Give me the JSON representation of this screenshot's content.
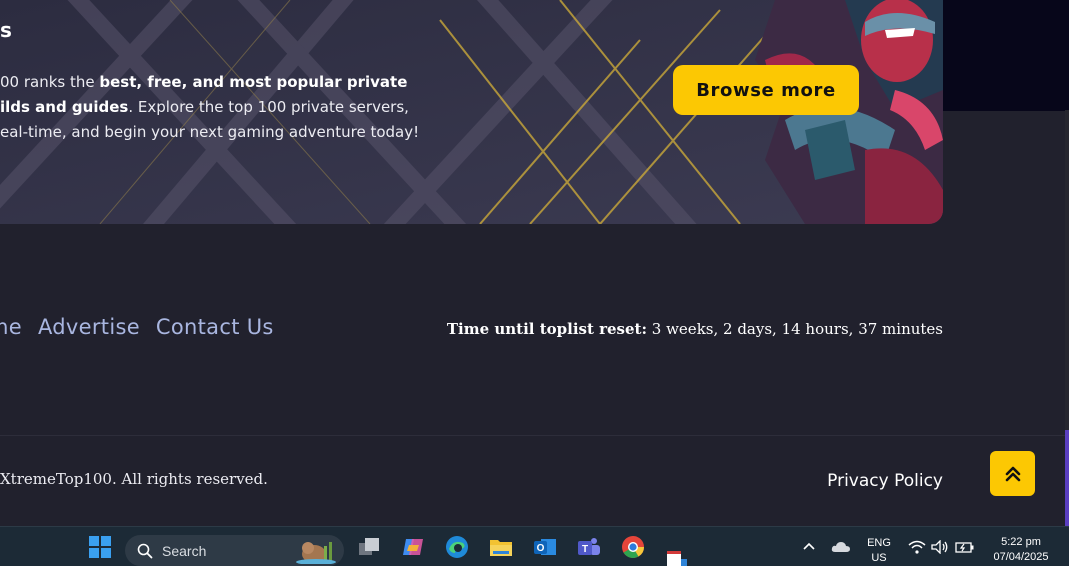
{
  "hero": {
    "title_fragment": "s",
    "line1_pre": "00 ranks the ",
    "line1_bold": "best, free, and most popular private",
    "line2_bold": "ilds and guides",
    "line2_post": ". Explore the top 100 private servers,",
    "line3": "eal-time, and begin your next gaming adventure today!",
    "browse_label": "Browse more"
  },
  "footer": {
    "links": [
      "me",
      "Advertise",
      "Contact Us"
    ],
    "reset_label": "Time until toplist reset:",
    "reset_value": " 3 weeks, 2 days, 14 hours, 37 minutes",
    "copyright": "XtremeTop100. All rights reserved.",
    "privacy": "Privacy Policy"
  },
  "taskbar": {
    "search_label": "Search",
    "lang_top": "ENG",
    "lang_bottom": "US",
    "time": "5:22 pm",
    "date": "07/04/2025"
  },
  "colors": {
    "accent": "#fcc803",
    "background": "#21212d",
    "link": "#a9b6e0"
  }
}
